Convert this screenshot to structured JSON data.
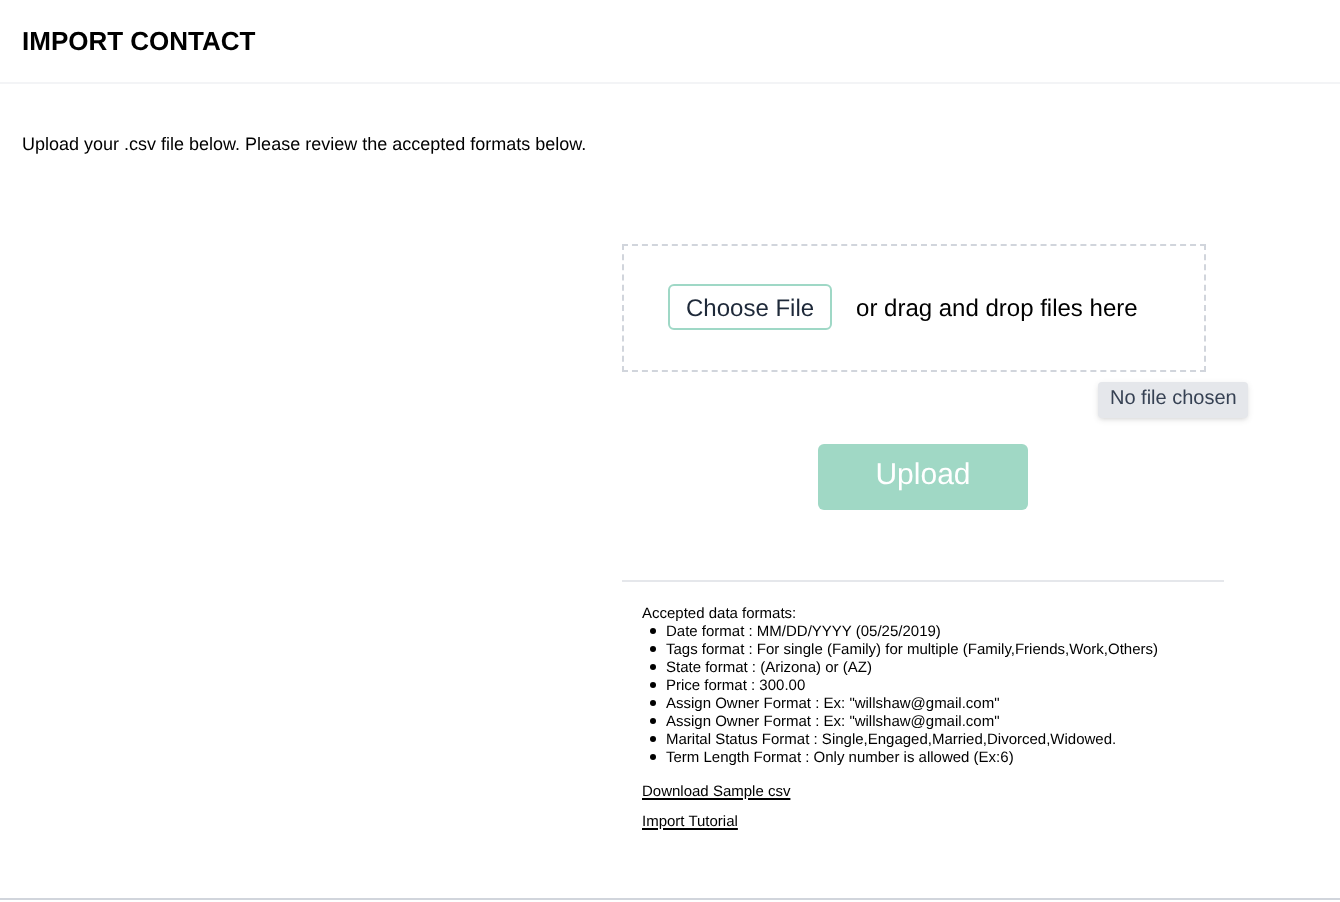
{
  "header": {
    "title": "IMPORT CONTACT"
  },
  "intro": "Upload your .csv file below. Please review the accepted formats below.",
  "dropzone": {
    "button": "Choose File",
    "hint": "or drag and drop files here",
    "tooltip": "No file chosen"
  },
  "upload_button": {
    "label": "Upload",
    "disabled": true
  },
  "formats": {
    "heading": "Accepted data formats:",
    "items": [
      "Date format : MM/DD/YYYY (05/25/2019)",
      "Tags format : For single (Family) for multiple (Family,Friends,Work,Others)",
      "State format : (Arizona) or (AZ)",
      "Price format : 300.00",
      "Assign Owner Format : Ex: \"willshaw@gmail.com\"",
      "Assign Owner Format : Ex: \"willshaw@gmail.com\"",
      "Marital Status Format : Single,Engaged,Married,Divorced,Widowed.",
      "Term Length Format : Only number is allowed (Ex:6)"
    ]
  },
  "links": [
    "Download Sample csv",
    "Import Tutorial"
  ]
}
